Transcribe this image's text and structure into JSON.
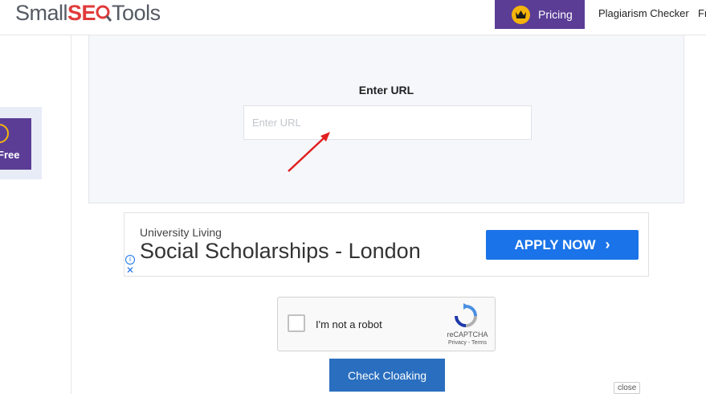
{
  "header": {
    "logo_pre": "Small",
    "logo_mid": "SE",
    "logo_post": "Tools",
    "pricing_label": "Pricing",
    "nav": [
      "Plagiarism Checker",
      "Fr"
    ]
  },
  "sidebar": {
    "promo_label": "Free"
  },
  "tool": {
    "title": "Enter URL",
    "input_placeholder": "Enter URL",
    "input_value": ""
  },
  "ad": {
    "brand": "University Living",
    "headline": "Social Scholarships - London",
    "cta": "APPLY NOW",
    "info_icon": "i",
    "close_icon": "✕"
  },
  "captcha": {
    "label": "I'm not a robot",
    "brand": "reCAPTCHA",
    "links": "Privacy - Terms"
  },
  "action": {
    "submit_label": "Check Cloaking"
  },
  "overlay": {
    "close_label": "close"
  },
  "colors": {
    "brand_purple": "#5b3d96",
    "logo_red": "#e03a3a",
    "crown_gold": "#f5b40c",
    "ad_blue": "#1a73e8",
    "submit_blue": "#2a6fbf",
    "annotation_arrow": "#e02020"
  }
}
